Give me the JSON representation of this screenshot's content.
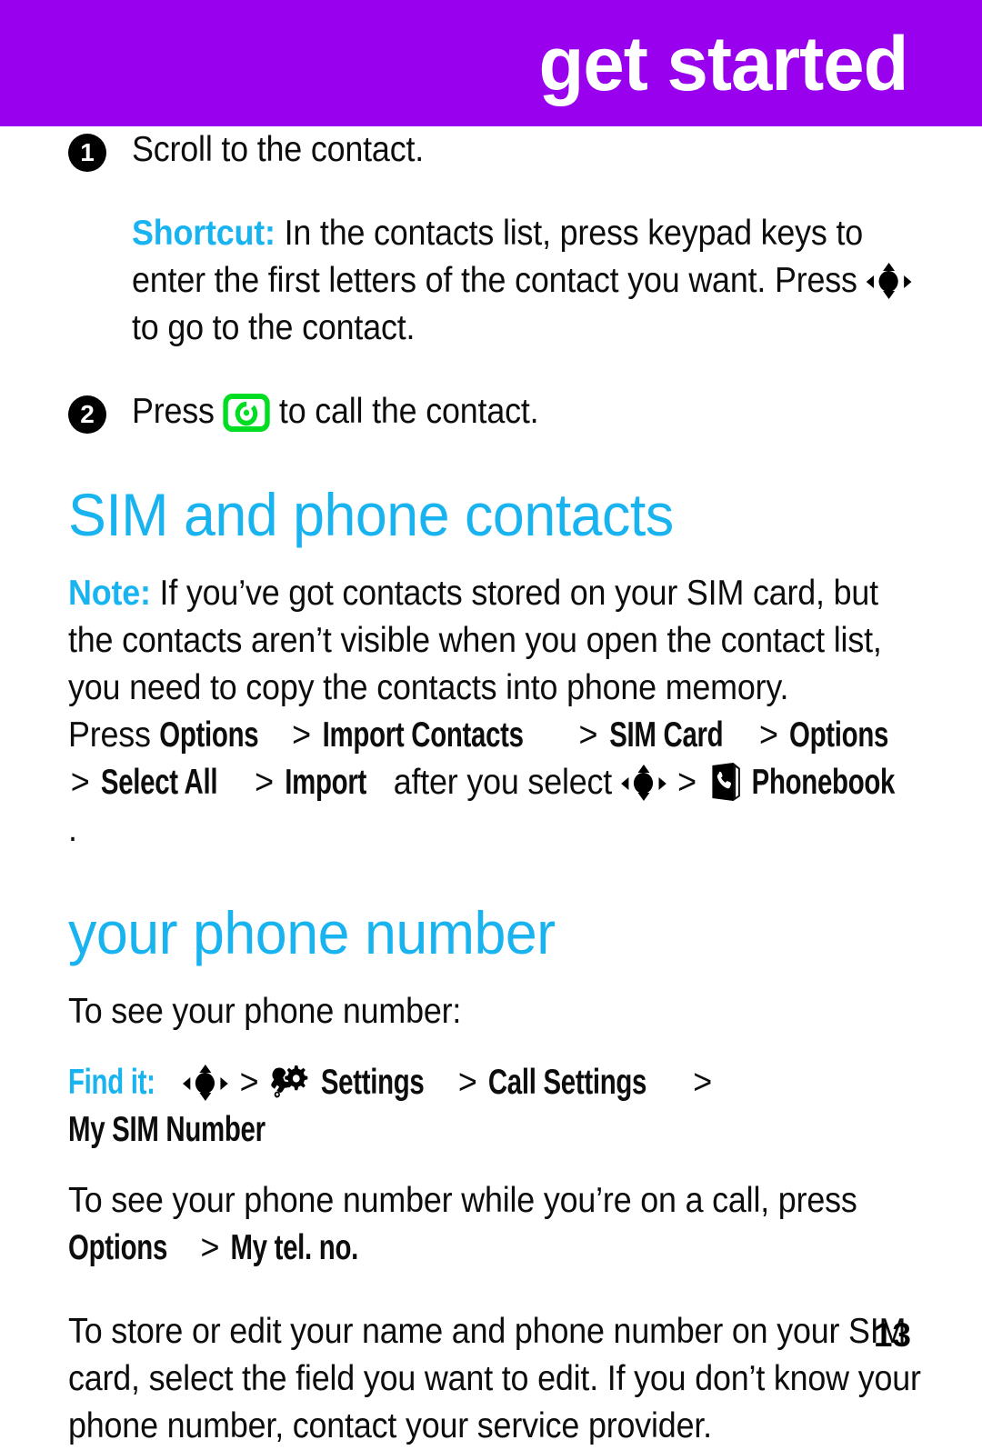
{
  "header": {
    "title": "get started",
    "banner_color": "#9900EE",
    "title_color": "#FFFFFF"
  },
  "theme": {
    "accent_cyan": "#19B4F0",
    "call_key_green": "#00DD22",
    "text_black": "#0D0D0D"
  },
  "steps": [
    {
      "number": "1",
      "text": "Scroll to the contact.",
      "note": {
        "lead": "Shortcut:",
        "text_before_icon": "In the contacts list, press keypad keys to enter the first letters of the contact you want. Press",
        "icon": "nav-key-icon",
        "text_after_icon": "to go to the contact."
      }
    },
    {
      "number": "2",
      "text_before_icon": "Press",
      "icon": "call-key-icon",
      "text_after_icon": "to call the contact."
    }
  ],
  "sections": [
    {
      "heading": "SIM and phone contacts",
      "note": {
        "lead": "Note:",
        "text": "If you’ve got contacts stored on your SIM card, but the contacts aren’t visible when you open the contact list, you need to copy the contacts into phone memory."
      },
      "menu_path": {
        "prefix": "Press",
        "items": [
          "Options",
          "Import Contacts",
          "SIM Card",
          "Options",
          "Select All",
          "Import"
        ],
        "separator": ">",
        "middle_text": "after you select",
        "nav_icon": "nav-key-icon",
        "book_icon": "phonebook-icon",
        "final_item": "Phonebook",
        "period": "."
      }
    },
    {
      "heading": "your phone number",
      "intro": "To see your phone number:",
      "find_it": {
        "label": "Find it:",
        "nav_icon": "nav-key-icon",
        "separator": ">",
        "settings_icon": "settings-icon",
        "items": [
          "Settings",
          "Call Settings",
          "My SIM Number"
        ]
      },
      "in_call": {
        "text": "To see your phone number while you’re on a call, press",
        "menu_items": [
          "Options",
          "My tel. no."
        ],
        "separator": ">"
      },
      "closing": "To store or edit your name and phone number on your SIM card, select the field you want to edit. If you don’t know your phone number, contact your service provider."
    }
  ],
  "footer": {
    "page_number": "13"
  }
}
